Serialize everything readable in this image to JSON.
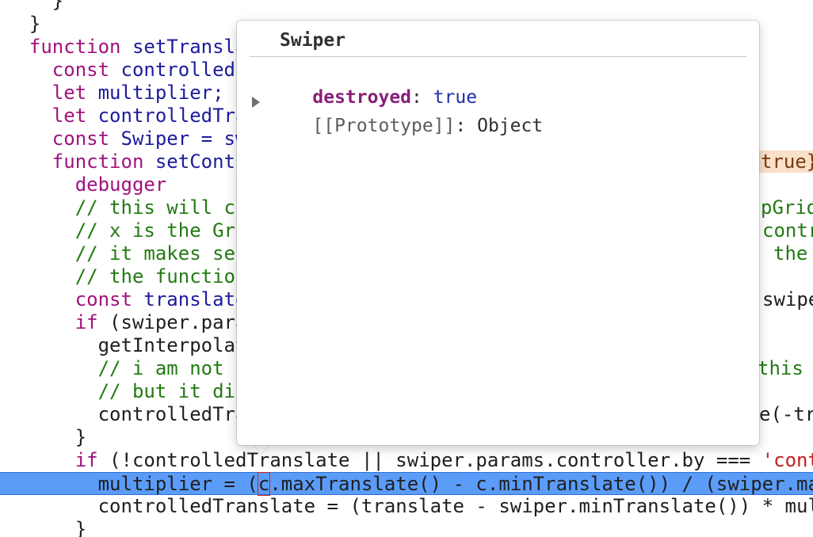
{
  "code": {
    "lines": [
      {
        "id": "l0",
        "segments": [
          {
            "t": "    }",
            "c": "id"
          }
        ]
      },
      {
        "id": "l1",
        "segments": [
          {
            "t": "  }",
            "c": "id"
          }
        ]
      },
      {
        "id": "l2",
        "segments": [
          {
            "t": "  ",
            "c": "id"
          },
          {
            "t": "function",
            "c": "kw"
          },
          {
            "t": " setTransla",
            "c": "fn"
          }
        ]
      },
      {
        "id": "l3",
        "segments": [
          {
            "t": "    ",
            "c": "id"
          },
          {
            "t": "const",
            "c": "kw"
          },
          {
            "t": " controlled",
            "c": "fn"
          }
        ]
      },
      {
        "id": "l4",
        "segments": [
          {
            "t": "    ",
            "c": "id"
          },
          {
            "t": "let",
            "c": "kw"
          },
          {
            "t": " multiplier;",
            "c": "fn"
          }
        ]
      },
      {
        "id": "l5",
        "segments": [
          {
            "t": "    ",
            "c": "id"
          },
          {
            "t": "let",
            "c": "kw"
          },
          {
            "t": " controlledTra",
            "c": "fn"
          }
        ]
      },
      {
        "id": "l6",
        "segments": [
          {
            "t": "    ",
            "c": "id"
          },
          {
            "t": "const",
            "c": "kw"
          },
          {
            "t": " Swiper = sw",
            "c": "fn"
          }
        ]
      },
      {
        "id": "l7",
        "segments": [
          {
            "t": "    ",
            "c": "id"
          },
          {
            "t": "function",
            "c": "kw"
          },
          {
            "t": " setContr",
            "c": "fn"
          }
        ]
      },
      {
        "id": "l8",
        "segments": [
          {
            "t": "      ",
            "c": "id"
          },
          {
            "t": "debugger",
            "c": "dbg"
          }
        ]
      },
      {
        "id": "l9",
        "segments": [
          {
            "t": "      // this will cr",
            "c": "cm"
          }
        ]
      },
      {
        "id": "l10",
        "segments": [
          {
            "t": "      // x is the Gri",
            "c": "cm"
          }
        ]
      },
      {
        "id": "l11",
        "segments": [
          {
            "t": "      // it makes ser",
            "c": "cm"
          }
        ]
      },
      {
        "id": "l12",
        "segments": [
          {
            "t": "      // the function",
            "c": "cm"
          }
        ]
      },
      {
        "id": "l13",
        "segments": [
          {
            "t": "      ",
            "c": "id"
          },
          {
            "t": "const",
            "c": "kw"
          },
          {
            "t": " translate",
            "c": "fn"
          }
        ]
      },
      {
        "id": "l14",
        "segments": [
          {
            "t": "      ",
            "c": "id"
          },
          {
            "t": "if",
            "c": "kw"
          },
          {
            "t": " (swiper.para",
            "c": "id"
          }
        ]
      },
      {
        "id": "l15",
        "segments": [
          {
            "t": "        getInterpolat",
            "c": "id"
          }
        ]
      },
      {
        "id": "l16",
        "segments": [
          {
            "t": "        // i am not s",
            "c": "cm"
          }
        ]
      },
      {
        "id": "l17",
        "segments": [
          {
            "t": "        // but it dic",
            "c": "cm"
          }
        ]
      },
      {
        "id": "l18",
        "segments": [
          {
            "t": "        controlledTra",
            "c": "id"
          }
        ]
      },
      {
        "id": "l19",
        "segments": [
          {
            "t": "      }",
            "c": "id"
          }
        ]
      },
      {
        "id": "l20",
        "segments": [
          {
            "t": "      ",
            "c": "id"
          },
          {
            "t": "if",
            "c": "kw"
          },
          {
            "t": " (!controlledTranslate || swiper.params.controller.by === ",
            "c": "id"
          },
          {
            "t": "'cont",
            "c": "str"
          }
        ]
      },
      {
        "id": "l21",
        "segments": [
          {
            "t": "        multiplier = (",
            "c": "id"
          },
          {
            "t": "c",
            "c": "cursor"
          },
          {
            "t": ".maxTranslate() - c.minTranslate()) / (swiper.ma",
            "c": "id"
          }
        ],
        "exec": true
      },
      {
        "id": "l22",
        "segments": [
          {
            "t": "        controlledTranslate = (translate - swiper.minTranslate()) * mul",
            "c": "id"
          }
        ]
      },
      {
        "id": "l23",
        "segments": [
          {
            "t": "      }",
            "c": "id"
          }
        ]
      }
    ],
    "right_fragments": [
      {
        "id": "r7",
        "text": "true}",
        "c": "hint"
      },
      {
        "id": "r9",
        "text": "pGrid",
        "c": "cm"
      },
      {
        "id": "r10",
        "text": "contr",
        "c": "cm"
      },
      {
        "id": "r11",
        "text": "the",
        "c": "cm"
      },
      {
        "id": "r13",
        "text": "swipe",
        "c": "id"
      },
      {
        "id": "r16",
        "text": "this w",
        "c": "cm"
      },
      {
        "id": "r18",
        "text": "e(-tr",
        "c": "id"
      }
    ]
  },
  "popover": {
    "title": "Swiper",
    "properties": [
      {
        "key": "destroyed",
        "sep": ": ",
        "value": "true"
      }
    ],
    "prototype": {
      "key": "[[Prototype]]",
      "sep": ": ",
      "value": "Object",
      "expand_icon": "triangle-right-icon"
    }
  },
  "colors": {
    "execution_line": "#5b9cf9",
    "keyword": "#a0127e",
    "comment": "#237a12",
    "string": "#c3201e",
    "popover_bg": "#ffffff"
  }
}
